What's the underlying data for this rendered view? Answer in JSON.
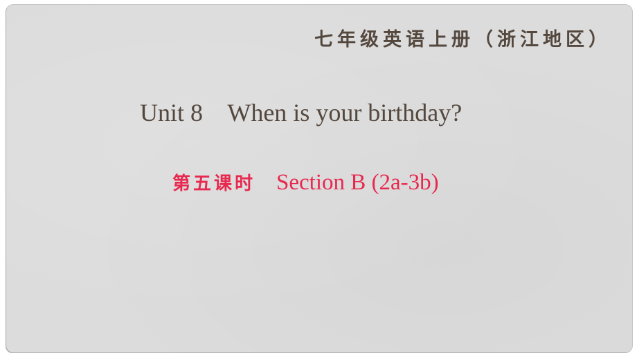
{
  "slide": {
    "header_title": "七年级英语上册（浙江地区）",
    "unit_title": "Unit 8    When is your birthday?",
    "lesson_label_cn": "第五课时",
    "lesson_section": "Section B (2a-3b)"
  },
  "colors": {
    "slide_background": "#dcdcdc",
    "heading_text": "#54483e",
    "accent_text": "#e8294f"
  }
}
